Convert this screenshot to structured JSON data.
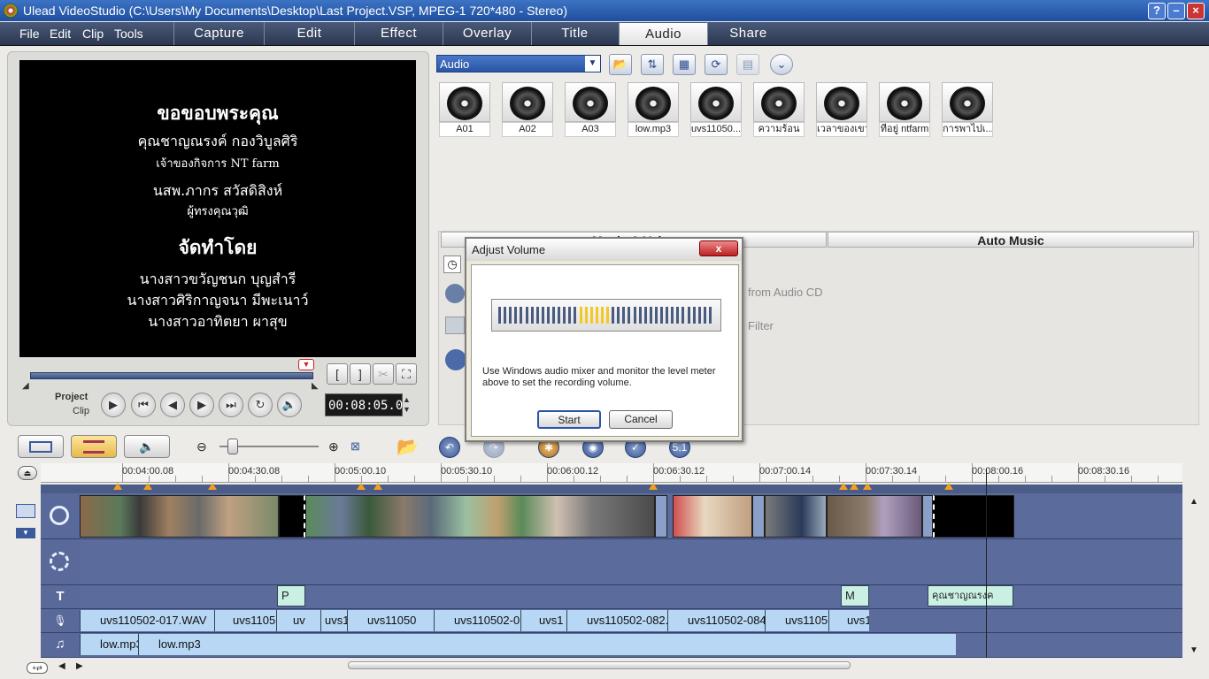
{
  "window": {
    "title": "Ulead VideoStudio (C:\\Users\\My Documents\\Desktop\\Last Project.VSP, MPEG-1 720*480 - Stereo)"
  },
  "menu": [
    "File",
    "Edit",
    "Clip",
    "Tools"
  ],
  "steps": [
    "Capture",
    "Edit",
    "Effect",
    "Overlay",
    "Title",
    "Audio",
    "Share"
  ],
  "active_step": "Audio",
  "preview": {
    "lines": [
      "ขอขอบพระคุณ",
      "คุณชาญณรงค์ กองวิบูลศิริ",
      "เจ้าของกิจการ NT farm",
      "นสพ.ภากร สวัสดิสิงห์",
      "ผู้ทรงคุณวุฒิ",
      "จัดทำโดย",
      "นางสาวขวัญชนก บุญสำรี",
      "นางสาวศิริกาญจนา มีพะเนาว์",
      "นางสาวอาทิตยา ผาสุข"
    ],
    "project_label": "Project",
    "clip_label": "Clip",
    "timecode": "00:08:05.0"
  },
  "library": {
    "category": "Audio",
    "items": [
      "A01",
      "A02",
      "A03",
      "low.mp3",
      "uvs11050...",
      "ความร้อน",
      "เวลาของเขา",
      "ที่อยู่ ntfarm",
      "การพาไปเ..."
    ]
  },
  "options": {
    "tabs": [
      "Music & Voice",
      "Auto Music"
    ],
    "ghost_items": [
      "from Audio CD",
      "Filter"
    ]
  },
  "dialog": {
    "title": "Adjust Volume",
    "close": "x",
    "meter_level": 0.45,
    "instruction": "Use Windows audio mixer and monitor the level meter above to set the recording volume.",
    "start": "Start",
    "cancel": "Cancel"
  },
  "ruler_ticks": [
    "00:04:00.08",
    "00:04:30.08",
    "00:05:00.10",
    "00:05:30.10",
    "00:06:00.12",
    "00:06:30.12",
    "00:07:00.14",
    "00:07:30.14",
    "00:08:00.16",
    "00:08:30.16"
  ],
  "title_clips": [
    "P",
    "M",
    "คุณชาญณรงค"
  ],
  "voice_clips": [
    "uvs110502-017.WAV",
    "uvs1105",
    "uv",
    "uvs1",
    "uvs11050",
    "uvs110502-0",
    "uvs1",
    "uvs110502-082.",
    "uvs110502-084",
    "uvs1105",
    "uvs1"
  ],
  "music_clips": [
    "low.mp3",
    "low.mp3"
  ],
  "colors": {
    "accent": "#2a55a5",
    "track_bg": "#5b6c9c",
    "audio_clip": "#b7d7f5",
    "title_clip": "#c9f0e2",
    "meter_on": "#f4c822"
  }
}
